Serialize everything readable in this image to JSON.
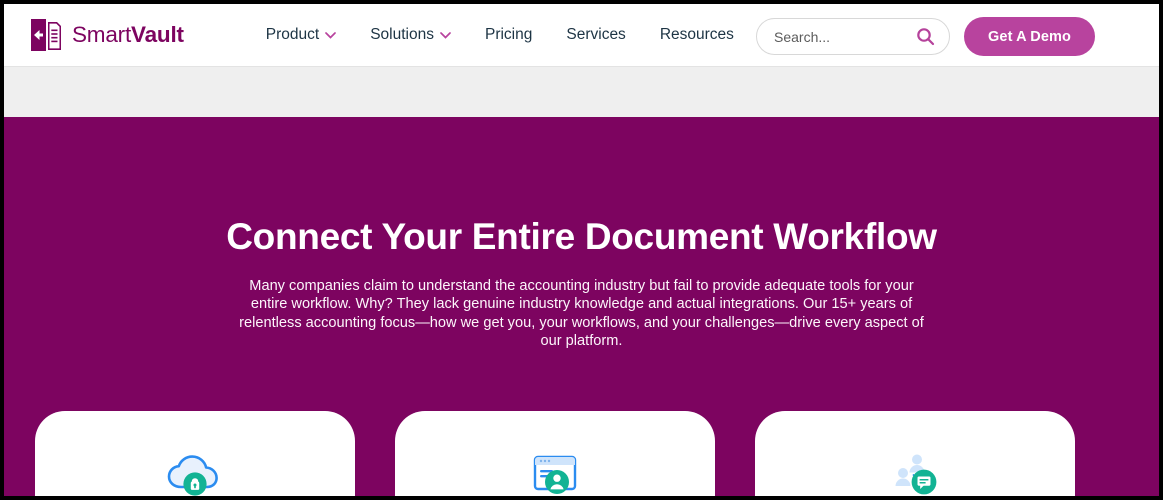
{
  "brand": {
    "name_light": "Smart",
    "name_bold": "Vault",
    "logo_icon": "vault-door-document-icon",
    "purple": "#7d0460",
    "magenta": "#b8439e",
    "navy": "#1d3444",
    "teal": "#12b394",
    "blue": "#2b8cf0"
  },
  "header": {
    "nav": [
      {
        "label": "Product",
        "has_dropdown": true,
        "icon": "chevron-down-icon"
      },
      {
        "label": "Solutions",
        "has_dropdown": true,
        "icon": "chevron-down-icon"
      },
      {
        "label": "Pricing",
        "has_dropdown": false
      },
      {
        "label": "Services",
        "has_dropdown": false
      },
      {
        "label": "Resources",
        "has_dropdown": false
      }
    ],
    "search": {
      "placeholder": "Search...",
      "value": "",
      "icon": "search-icon"
    },
    "cta": {
      "label": "Get A Demo"
    }
  },
  "hero": {
    "title": "Connect Your Entire Document Workflow",
    "subtitle": "Many companies claim to understand the accounting industry but fail to provide adequate tools for your entire workflow. Why? They lack genuine industry knowledge and actual integrations. Our 15+ years of relentless accounting focus—how we get you, your workflows, and your challenges—drive every aspect of our platform."
  },
  "cards": [
    {
      "icon": "cloud-lock-icon"
    },
    {
      "icon": "client-portal-user-icon"
    },
    {
      "icon": "people-chat-icon"
    }
  ]
}
